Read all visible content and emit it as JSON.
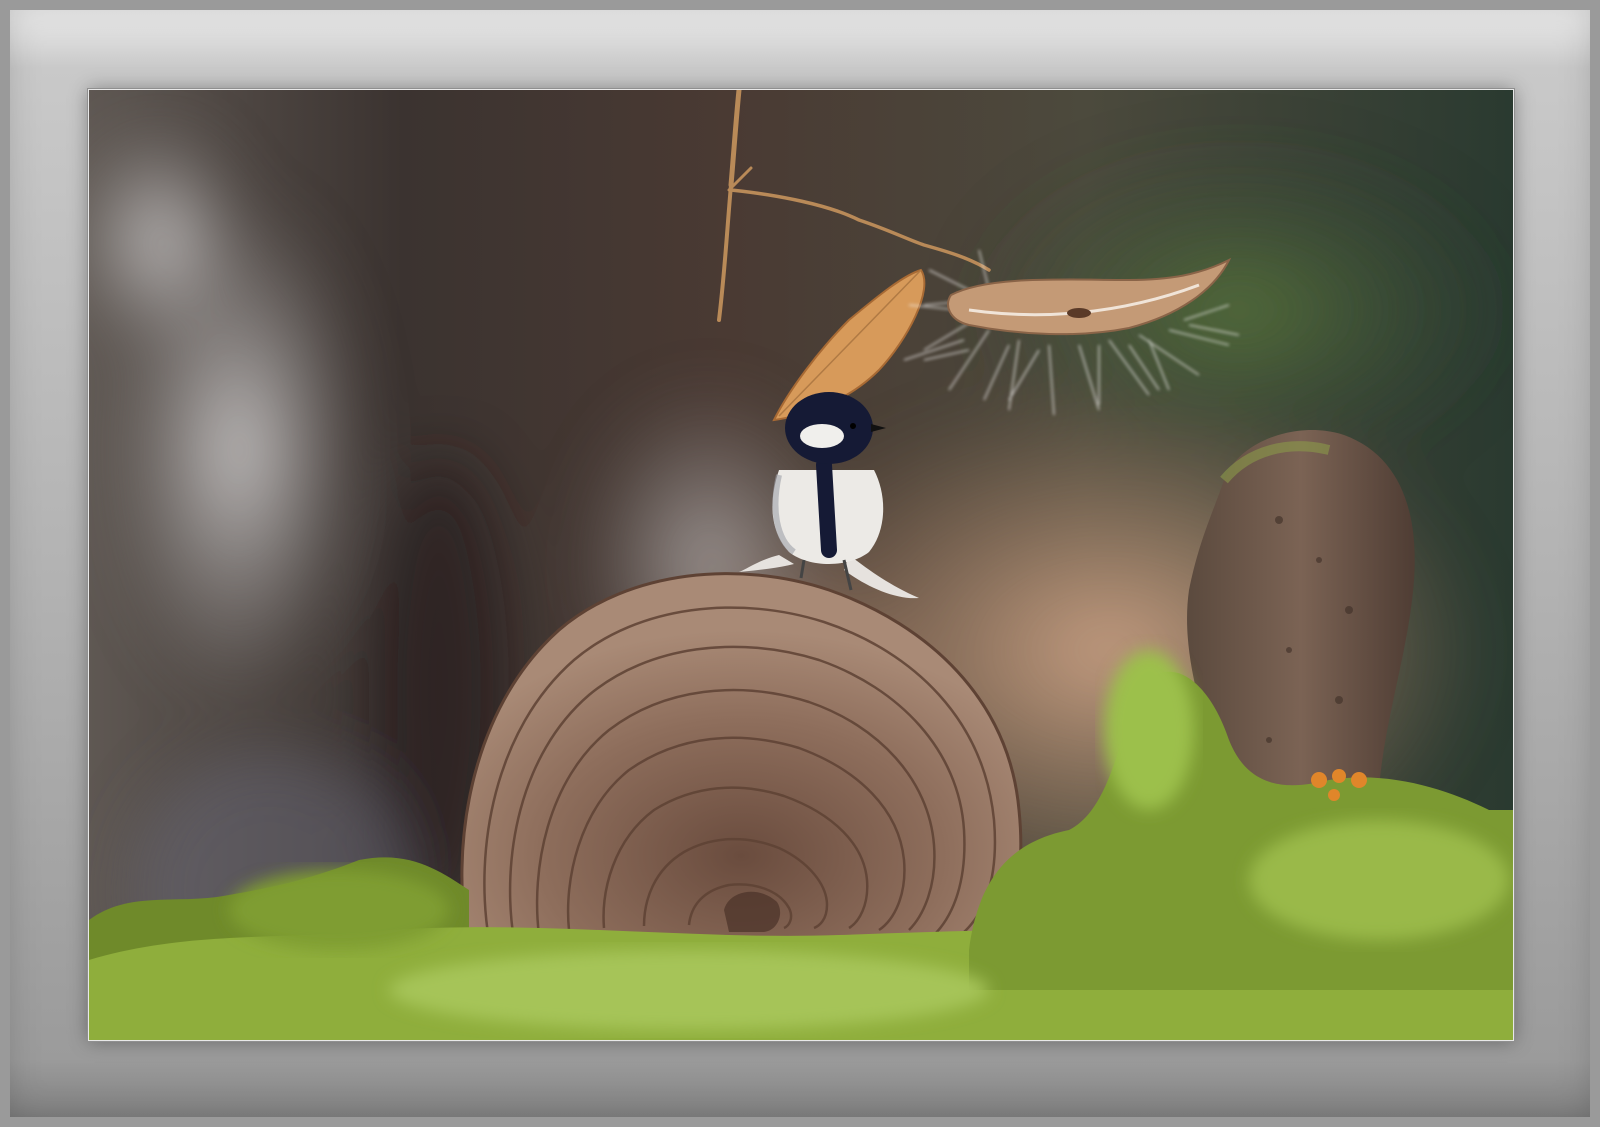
{
  "scene": {
    "kind": "nature photograph",
    "subjects": [
      "bird-icon",
      "bracket-fungus-icon",
      "moss-icon",
      "rock-icon",
      "twig-icon",
      "dry-leaf-icon",
      "seed-pod-icon"
    ],
    "colors": {
      "frame_light": "#d0d0d0",
      "frame_dark": "#8a8a8a",
      "bokeh_dark": "#3a3432",
      "bokeh_warm": "#b58a6e",
      "bokeh_green": "#2f4a34",
      "fungus": "#8a6a57",
      "moss": "#8aa63a",
      "bird_head": "#151a35",
      "bird_cheek": "#e8e8e6",
      "rock": "#6d5548"
    }
  }
}
